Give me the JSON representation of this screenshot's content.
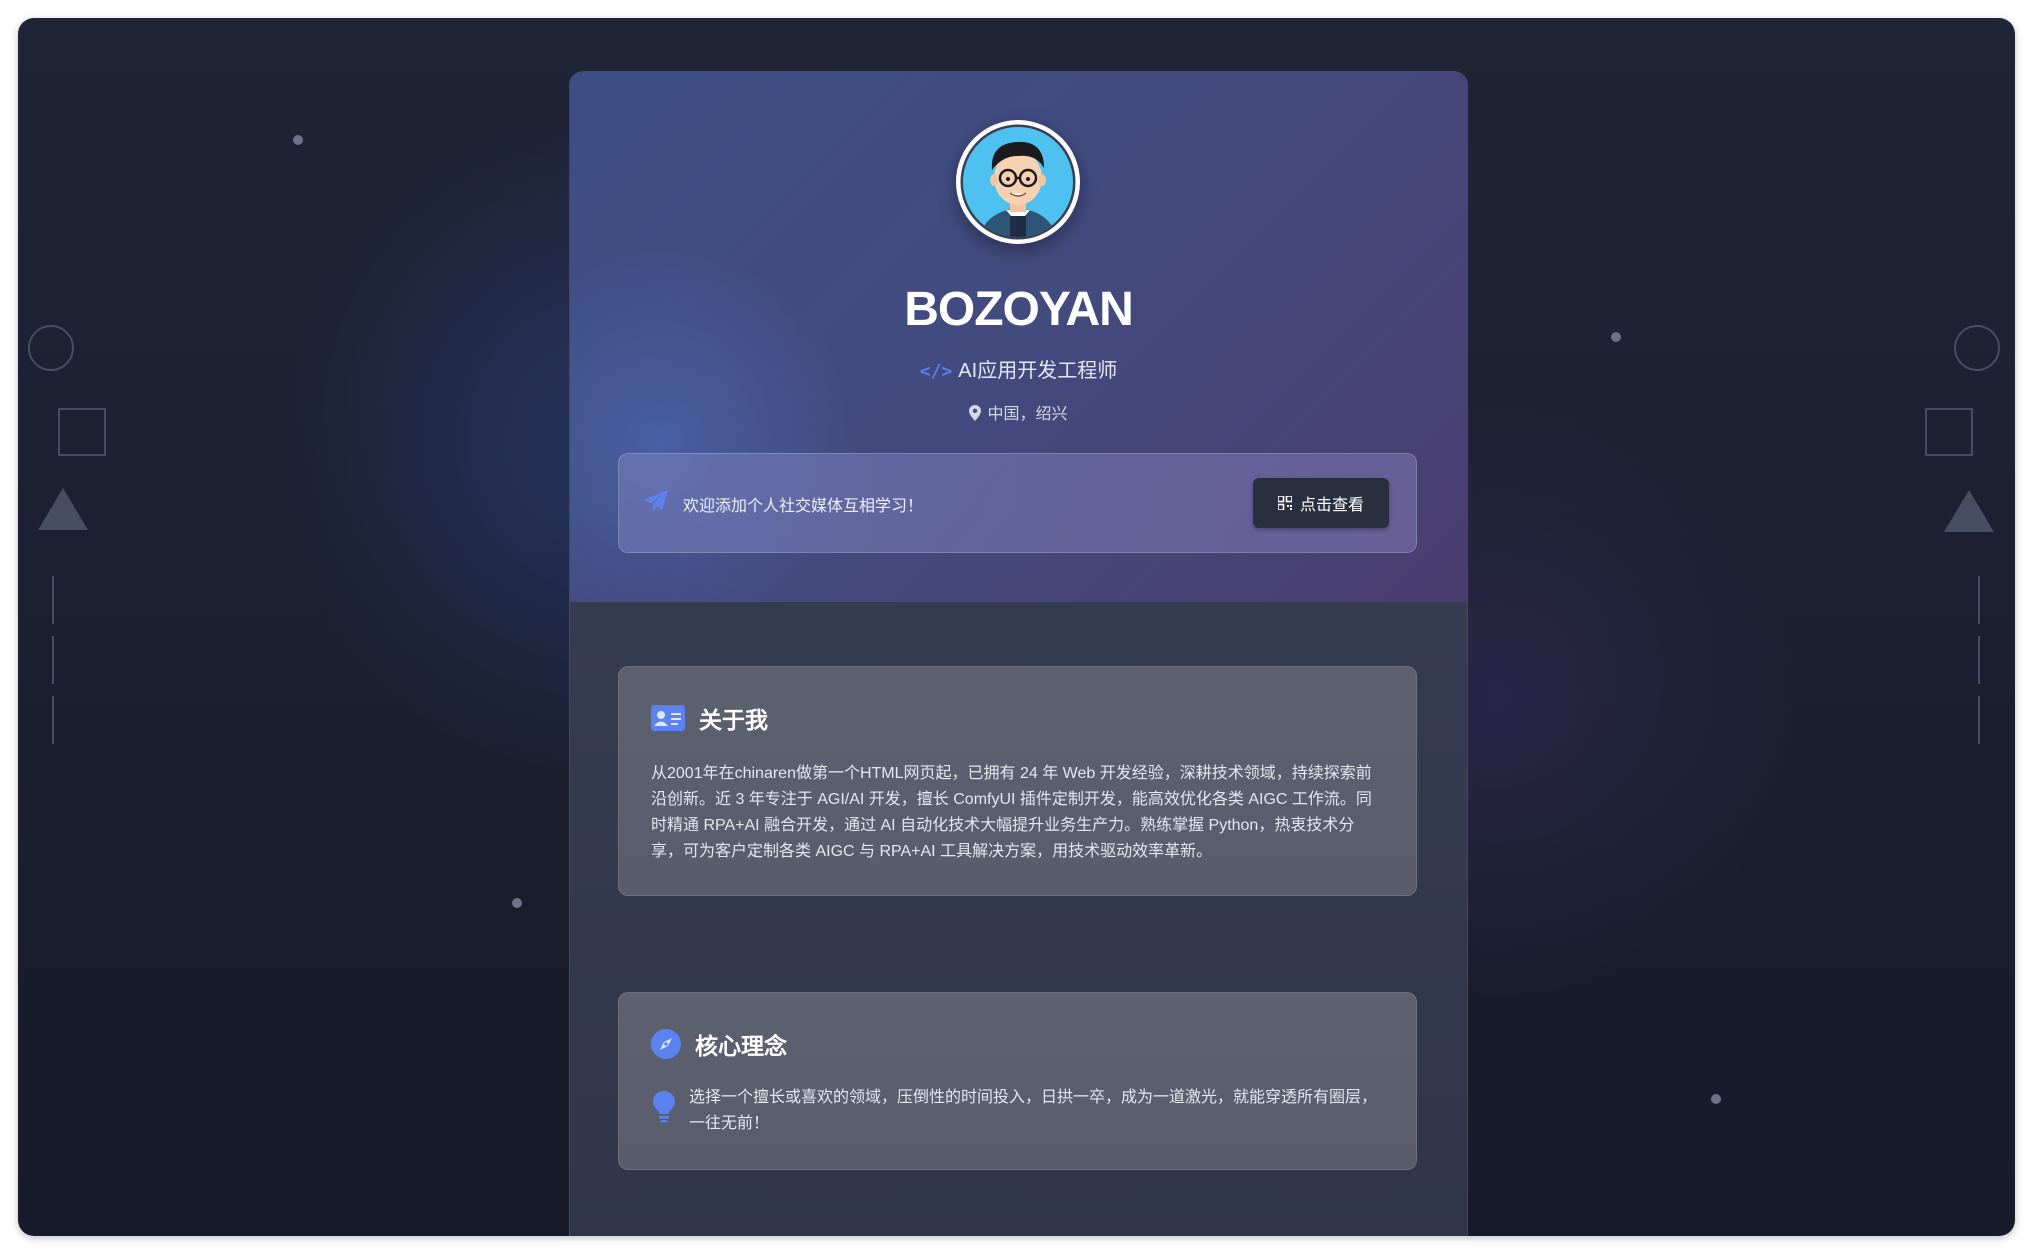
{
  "profile": {
    "name": "BOZOYAN",
    "title": "AI应用开发工程师",
    "location": "中国，绍兴",
    "avatar_icon": "avatar-cartoon-glasses"
  },
  "banner": {
    "text": "欢迎添加个人社交媒体互相学习！",
    "button_label": "点击查看",
    "icon": "paper-plane-icon"
  },
  "about": {
    "heading": "关于我",
    "icon": "id-card-icon",
    "body": "从2001年在chinaren做第一个HTML网页起，已拥有 24 年 Web 开发经验，深耕技术领域，持续探索前沿创新。近 3 年专注于 AGI/AI 开发，擅长 ComfyUI 插件定制开发，能高效优化各类 AIGC 工作流。同时精通 RPA+AI 融合开发，通过 AI 自动化技术大幅提升业务生产力。熟练掌握 Python，热衷技术分享，可为客户定制各类 AIGC 与 RPA+AI 工具解决方案，用技术驱动效率革新。"
  },
  "core": {
    "heading": "核心理念",
    "icon": "compass-icon",
    "body": "选择一个擅长或喜欢的领域，压倒性的时间投入，日拱一卒，成为一道激光，就能穿透所有圈层，一往无前！"
  },
  "colors": {
    "accent": "#5b82f0",
    "background": "#1c2133",
    "card": "#303548"
  }
}
